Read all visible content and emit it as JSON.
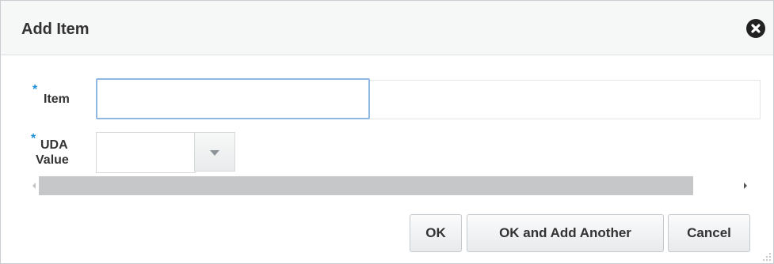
{
  "dialog": {
    "title": "Add Item",
    "close_icon": "close-circle-icon"
  },
  "form": {
    "item": {
      "required_mark": "*",
      "label": "Item",
      "value": ""
    },
    "uda_value": {
      "required_mark": "*",
      "label_line1": "UDA",
      "label_line2": "Value",
      "selected_value": "",
      "dropdown_icon": "chevron-down-icon"
    }
  },
  "buttons": {
    "ok": "OK",
    "ok_and_add_another": "OK and Add Another",
    "cancel": "Cancel"
  },
  "colors": {
    "required": "#1f8fd6",
    "focus_border": "#90b8e3",
    "title_bar": "#f6f7f7"
  }
}
